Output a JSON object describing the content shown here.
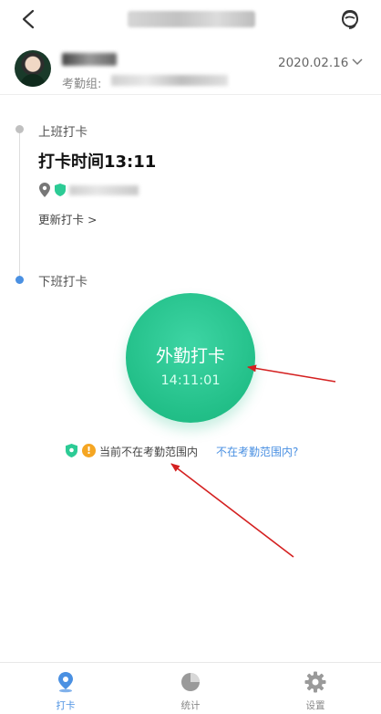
{
  "header": {
    "title": ""
  },
  "user": {
    "group_label": "考勤组:",
    "date": "2020.02.16"
  },
  "timeline": {
    "on_duty_label": "上班打卡",
    "punch_time": "打卡时间13:11",
    "update_label": "更新打卡 >",
    "off_duty_label": "下班打卡"
  },
  "punch_button": {
    "label": "外勤打卡",
    "clock": "14:11:01"
  },
  "range": {
    "warn_mark": "!",
    "status_text": "当前不在考勤范围内",
    "link_text": "不在考勤范围内?"
  },
  "tabs": [
    {
      "label": "打卡",
      "icon": "location-icon",
      "active": true
    },
    {
      "label": "统计",
      "icon": "pie-chart-icon",
      "active": false
    },
    {
      "label": "设置",
      "icon": "gear-icon",
      "active": false
    }
  ],
  "colors": {
    "accent": "#4a90e2",
    "punch_green": "#2ccb95",
    "warning": "#f5a623",
    "annotation_arrow": "#d42020"
  }
}
